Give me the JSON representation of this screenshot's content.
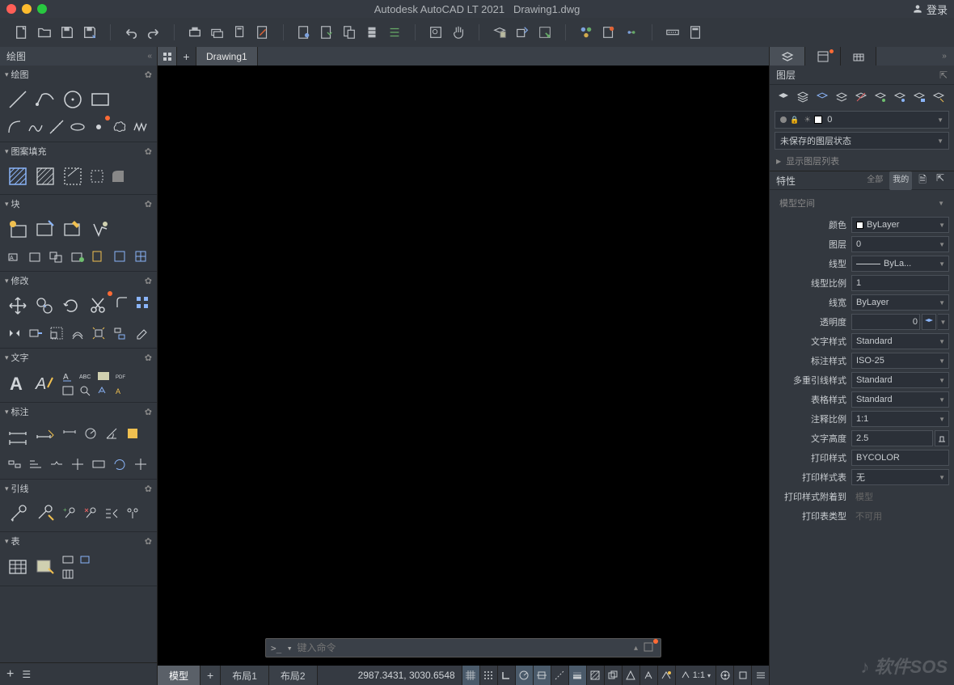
{
  "title": {
    "app": "Autodesk AutoCAD LT 2021",
    "doc": "Drawing1.dwg"
  },
  "login": "登录",
  "left_panel_title": "绘图",
  "sections": {
    "draw": "绘图",
    "hatch": "图案填充",
    "block": "块",
    "modify": "修改",
    "text": "文字",
    "dim": "标注",
    "leader": "引线",
    "table": "表"
  },
  "file_tab": "Drawing1",
  "cmd_placeholder": "键入命令",
  "layout_tabs": {
    "model": "模型",
    "l1": "布局1",
    "l2": "布局2"
  },
  "coords": "2987.3431, 3030.6548",
  "status_ratio": "1:1",
  "right": {
    "layers_title": "图层",
    "cur_layer": "0",
    "unsaved_state": "未保存的图层状态",
    "show_list": "显示图层列表",
    "props_title": "特性",
    "btn_all": "全部",
    "btn_my": "我的",
    "space": "模型空间",
    "rows": {
      "color": {
        "label": "颜色",
        "val": "ByLayer"
      },
      "layer": {
        "label": "图层",
        "val": "0"
      },
      "ltype": {
        "label": "线型",
        "val": "ByLa..."
      },
      "ltscale": {
        "label": "线型比例",
        "val": "1"
      },
      "lweight": {
        "label": "线宽",
        "val": "ByLayer"
      },
      "transp": {
        "label": "透明度",
        "val": "0"
      },
      "tstyle": {
        "label": "文字样式",
        "val": "Standard"
      },
      "dstyle": {
        "label": "标注样式",
        "val": "ISO-25"
      },
      "mleader": {
        "label": "多重引线样式",
        "val": "Standard"
      },
      "tblstyle": {
        "label": "表格样式",
        "val": "Standard"
      },
      "annoscale": {
        "label": "注释比例",
        "val": "1:1"
      },
      "txtheight": {
        "label": "文字高度",
        "val": "2.5"
      },
      "pstyle": {
        "label": "打印样式",
        "val": "BYCOLOR"
      },
      "ptable": {
        "label": "打印样式表",
        "val": "无"
      },
      "pattach": {
        "label": "打印样式附着到",
        "val": "模型"
      },
      "ptype": {
        "label": "打印表类型",
        "val": "不可用"
      }
    }
  },
  "watermark": "软件SOS"
}
